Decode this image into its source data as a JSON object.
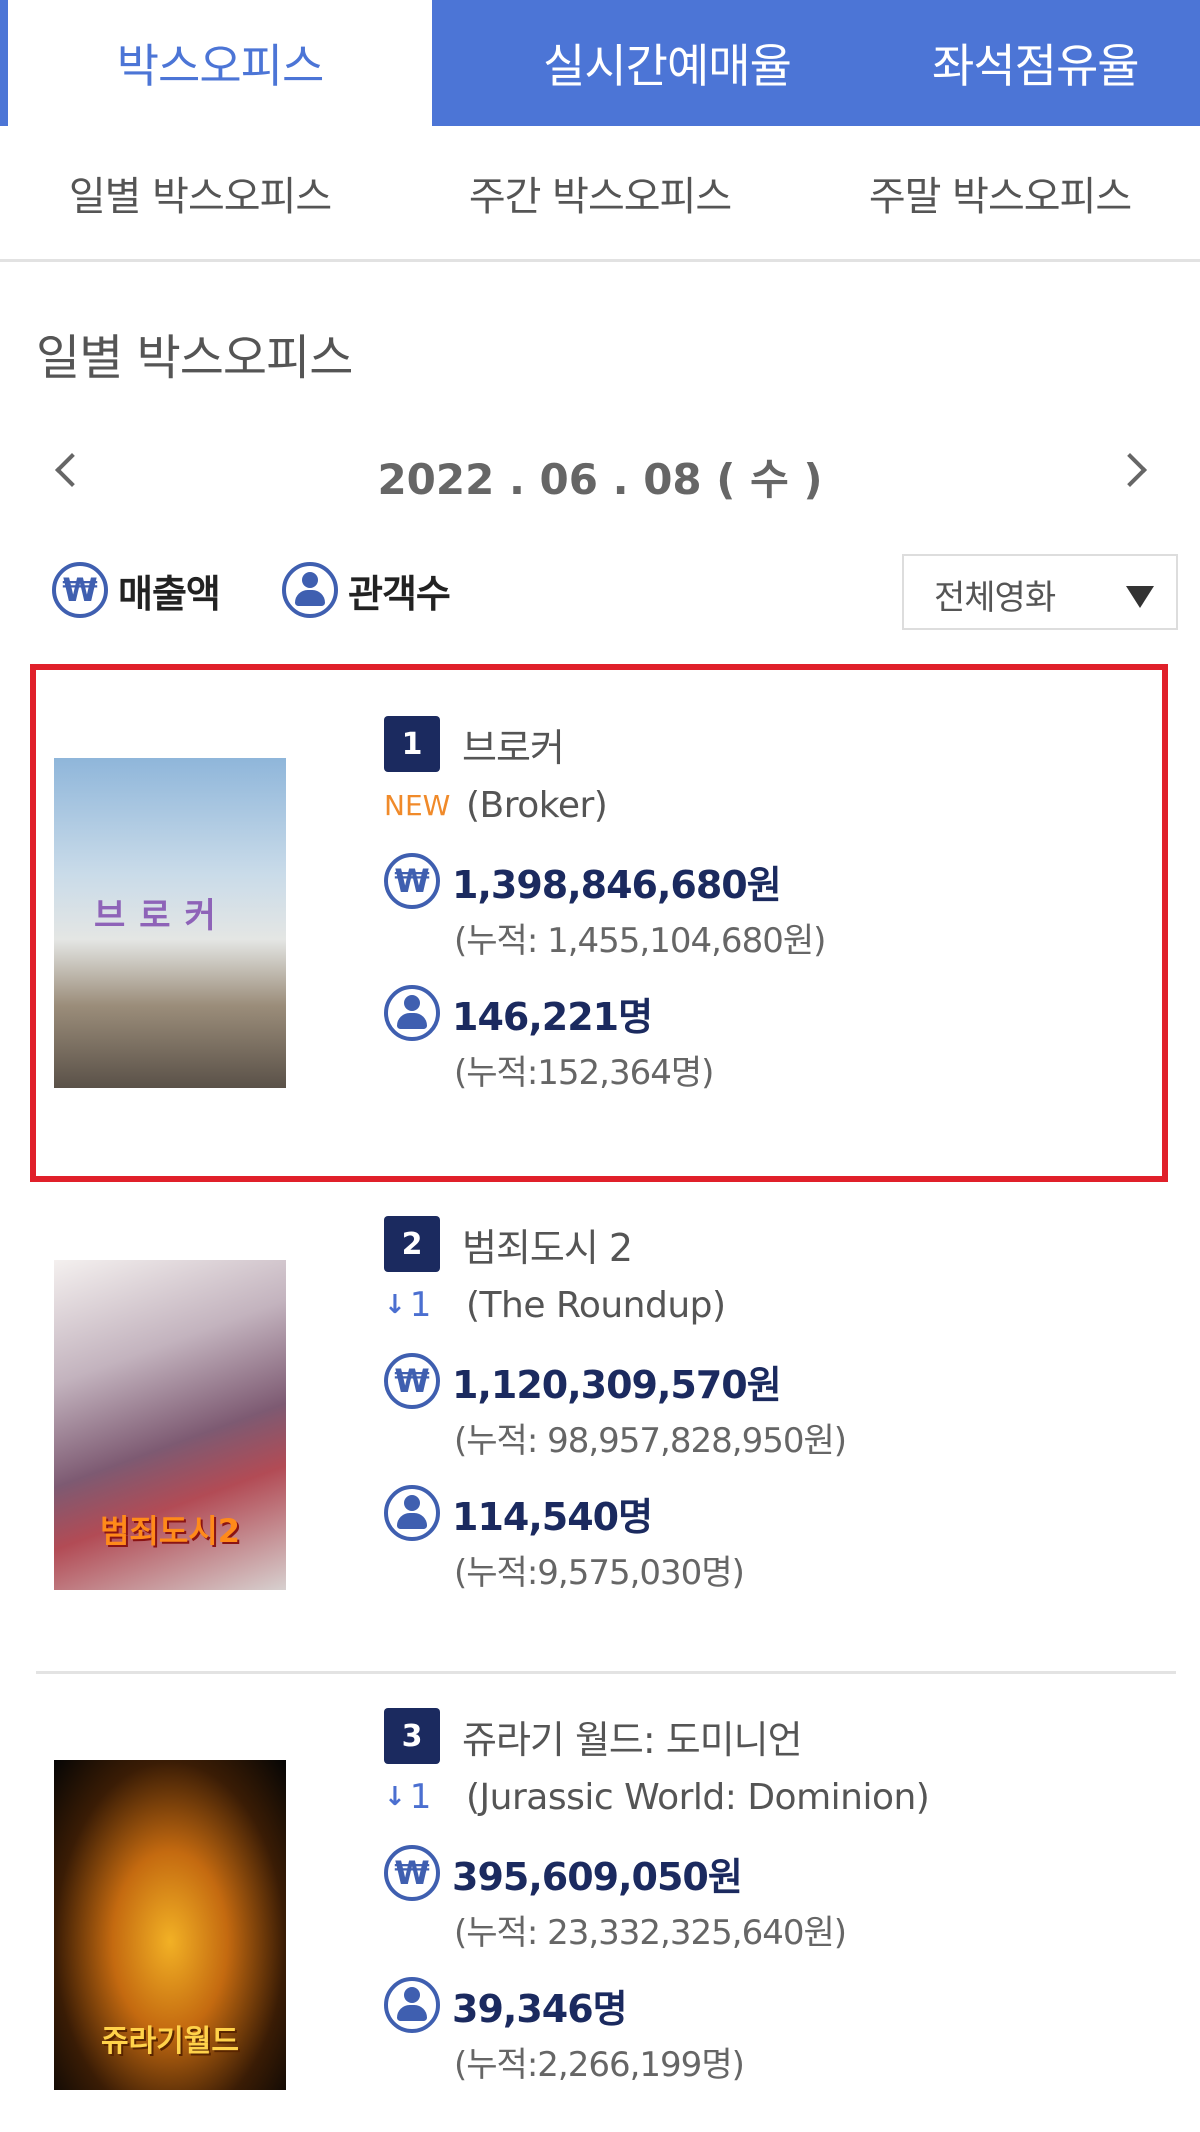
{
  "top_tabs": [
    "박스오피스",
    "실시간예매율",
    "좌석점유율"
  ],
  "sub_tabs": [
    "일별 박스오피스",
    "주간 박스오피스",
    "주말 박스오피스"
  ],
  "section_title": "일별 박스오피스",
  "date": "2022 . 06 . 08 ( 수 )",
  "legend": {
    "revenue_label": "매출액",
    "audience_label": "관객수",
    "won_symbol": "₩"
  },
  "filter": {
    "selected": "전체영화"
  },
  "colors": {
    "accent": "#4c75d6",
    "navy": "#1b2a5f",
    "highlight": "#e0202a",
    "new": "#f08a2a"
  },
  "movies": [
    {
      "rank": "1",
      "title": "브로커",
      "status": "NEW",
      "title_en": "(Broker)",
      "revenue": "1,398,846,680원",
      "revenue_cumulative": "(누적: 1,455,104,680원)",
      "audience": "146,221명",
      "audience_cumulative": "(누적:152,364명)",
      "poster_text": "브로커"
    },
    {
      "rank": "2",
      "title": "범죄도시 2",
      "change": "1",
      "change_icon": "arrow-down-icon",
      "title_en": "(The Roundup)",
      "revenue": "1,120,309,570원",
      "revenue_cumulative": "(누적: 98,957,828,950원)",
      "audience": "114,540명",
      "audience_cumulative": "(누적:9,575,030명)",
      "poster_text": "범죄도시2"
    },
    {
      "rank": "3",
      "title": "쥬라기 월드: 도미니언",
      "change": "1",
      "change_icon": "arrow-down-icon",
      "title_en": "(Jurassic World: Dominion)",
      "revenue": "395,609,050원",
      "revenue_cumulative": "(누적: 23,332,325,640원)",
      "audience": "39,346명",
      "audience_cumulative": "(누적:2,266,199명)",
      "poster_text": "쥬라기월드"
    }
  ]
}
